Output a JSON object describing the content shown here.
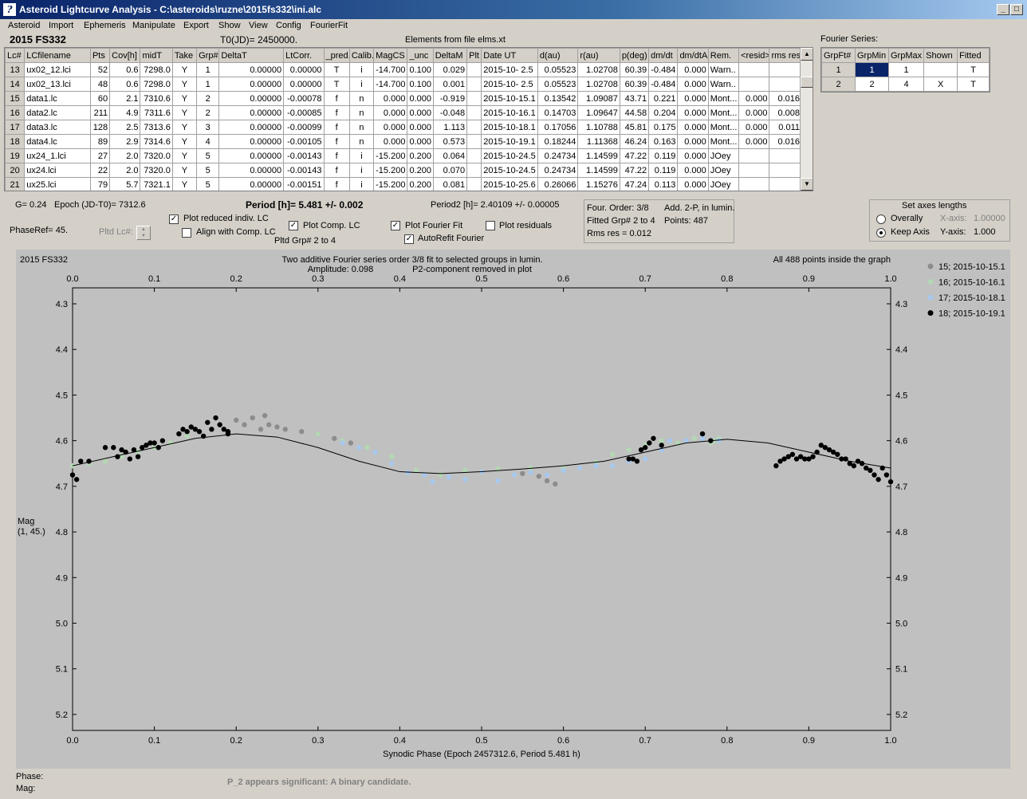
{
  "window": {
    "title": "Asteroid Lightcurve Analysis - C:\\asteroids\\ruzne\\2015fs332\\ini.alc",
    "icon": "curve-icon",
    "minimize": "_",
    "maximize": "□",
    "close": "×"
  },
  "menu": [
    "Asteroid",
    "Import",
    "Ephemeris",
    "Manipulate",
    "Export",
    "Show",
    "View",
    "Config",
    "FourierFit"
  ],
  "header": {
    "asteroid": "2015 FS332",
    "t0": "T0(JD)= 2450000.",
    "elements": "Elements from file elms.xt"
  },
  "lc_table": {
    "columns": [
      "Lc#",
      "LCfilename",
      "Pts",
      "Cov[h]",
      "midT",
      "Take",
      "Grp#",
      "DeltaT",
      "LtCorr.",
      "_pred.",
      "Calib.",
      "MagCS",
      "_unc",
      "DeltaM",
      "Plt",
      "Date UT",
      "d(au)",
      "r(au)",
      "p(deg)",
      "dm/dt",
      "dm/dtA",
      "Rem.",
      "<resid>",
      "rms res"
    ],
    "rows": [
      [
        "13",
        "ux02_12.lci",
        "52",
        "0.6",
        "7298.0",
        "Y",
        "1",
        "0.00000",
        "0.00000",
        "T",
        "i",
        "-14.700",
        "0.100",
        "0.029",
        "",
        "2015-10- 2.5",
        "0.05523",
        "1.02708",
        "60.39",
        "-0.484",
        "0.000",
        "Warn..",
        "",
        ""
      ],
      [
        "14",
        "ux02_13.lci",
        "48",
        "0.6",
        "7298.0",
        "Y",
        "1",
        "0.00000",
        "0.00000",
        "T",
        "i",
        "-14.700",
        "0.100",
        "0.001",
        "",
        "2015-10- 2.5",
        "0.05523",
        "1.02708",
        "60.39",
        "-0.484",
        "0.000",
        "Warn..",
        "",
        ""
      ],
      [
        "15",
        "data1.lc",
        "60",
        "2.1",
        "7310.6",
        "Y",
        "2",
        "0.00000",
        "-0.00078",
        "f",
        "n",
        "0.000",
        "0.000",
        "-0.919",
        "",
        "2015-10-15.1",
        "0.13542",
        "1.09087",
        "43.71",
        "0.221",
        "0.000",
        "Mont...",
        "0.000",
        "0.016"
      ],
      [
        "16",
        "data2.lc",
        "211",
        "4.9",
        "7311.6",
        "Y",
        "2",
        "0.00000",
        "-0.00085",
        "f",
        "n",
        "0.000",
        "0.000",
        "-0.048",
        "",
        "2015-10-16.1",
        "0.14703",
        "1.09647",
        "44.58",
        "0.204",
        "0.000",
        "Mont...",
        "0.000",
        "0.008"
      ],
      [
        "17",
        "data3.lc",
        "128",
        "2.5",
        "7313.6",
        "Y",
        "3",
        "0.00000",
        "-0.00099",
        "f",
        "n",
        "0.000",
        "0.000",
        "1.113",
        "",
        "2015-10-18.1",
        "0.17056",
        "1.10788",
        "45.81",
        "0.175",
        "0.000",
        "Mont...",
        "0.000",
        "0.011"
      ],
      [
        "18",
        "data4.lc",
        "89",
        "2.9",
        "7314.6",
        "Y",
        "4",
        "0.00000",
        "-0.00105",
        "f",
        "n",
        "0.000",
        "0.000",
        "0.573",
        "",
        "2015-10-19.1",
        "0.18244",
        "1.11368",
        "46.24",
        "0.163",
        "0.000",
        "Mont...",
        "0.000",
        "0.016"
      ],
      [
        "19",
        "ux24_1.lci",
        "27",
        "2.0",
        "7320.0",
        "Y",
        "5",
        "0.00000",
        "-0.00143",
        "f",
        "i",
        "-15.200",
        "0.200",
        "0.064",
        "",
        "2015-10-24.5",
        "0.24734",
        "1.14599",
        "47.22",
        "0.119",
        "0.000",
        "JOey",
        "",
        ""
      ],
      [
        "20",
        "ux24.lci",
        "22",
        "2.0",
        "7320.0",
        "Y",
        "5",
        "0.00000",
        "-0.00143",
        "f",
        "i",
        "-15.200",
        "0.200",
        "0.070",
        "",
        "2015-10-24.5",
        "0.24734",
        "1.14599",
        "47.22",
        "0.119",
        "0.000",
        "JOey",
        "",
        ""
      ],
      [
        "21",
        "ux25.lci",
        "79",
        "5.7",
        "7321.1",
        "Y",
        "5",
        "0.00000",
        "-0.00151",
        "f",
        "i",
        "-15.200",
        "0.200",
        "0.081",
        "",
        "2015-10-25.6",
        "0.26066",
        "1.15276",
        "47.24",
        "0.113",
        "0.000",
        "JOey",
        "",
        ""
      ]
    ]
  },
  "fourier_series": {
    "title": "Fourier Series:",
    "columns": [
      "GrpFt#",
      "GrpMin",
      "GrpMax",
      "Shown",
      "Fitted"
    ],
    "rows": [
      [
        "1",
        "1",
        "1",
        "",
        "T"
      ],
      [
        "2",
        "2",
        "4",
        "X",
        "T"
      ]
    ]
  },
  "controls": {
    "g": "G= 0.24",
    "epoch": "Epoch (JD-T0)= 7312.6",
    "period": "Period [h]= 5.481 +/- 0.002",
    "period2": "Period2 [h]= 2.40109 +/- 0.00005",
    "phaseref": "PhaseRef= 45.",
    "pltd_lc": "Pltd Lc#:",
    "plot_reduced": "Plot reduced indiv. LC",
    "align_comp": "Align with Comp. LC",
    "plot_comp": "Plot Comp. LC",
    "pltd_grp": "Pltd Grp#  2   to   4",
    "plot_fourier": "Plot Fourier Fit",
    "autorefit": "AutoRefit Fourier",
    "plot_residuals": "Plot residuals",
    "checks": {
      "plot_reduced": true,
      "align_comp": false,
      "plot_comp": true,
      "plot_fourier": true,
      "autorefit": true,
      "plot_residuals": false
    }
  },
  "fit_info": {
    "order": "Four. Order:  3/8",
    "add": "Add. 2-P, in lumin.",
    "fitted": "Fitted Grp# 2 to 4",
    "points": "Points: 487",
    "rms": "Rms res     = 0.012"
  },
  "axes": {
    "title": "Set axes lengths",
    "overally": "Overally",
    "keep": "Keep Axis",
    "xaxis_label": "X-axis:",
    "xaxis_value": "1.00000",
    "yaxis_label": "Y-axis:",
    "yaxis_value": "1.000",
    "selected": "keep"
  },
  "plot": {
    "name": "2015 FS332",
    "title": "Two additive Fourier series order 3/8 fit to selected groups in lumin.",
    "amplitude": "Amplitude: 0.098",
    "p2note": "P2-component removed in plot",
    "points_note": "All 488 points inside the graph",
    "ylabel": "Mag",
    "ylabel2": "(1, 45.)",
    "xlabel": "Synodic Phase (Epoch 2457312.6, Period 5.481 h)",
    "x_ticks": [
      "0.0",
      "0.1",
      "0.2",
      "0.3",
      "0.4",
      "0.5",
      "0.6",
      "0.7",
      "0.8",
      "0.9",
      "1.0"
    ],
    "y_ticks": [
      "4.3",
      "4.4",
      "4.5",
      "4.6",
      "4.7",
      "4.8",
      "4.9",
      "5.0",
      "5.1",
      "5.2"
    ]
  },
  "chart_data": {
    "type": "scatter",
    "title": "Two additive Fourier series order 3/8 fit to selected groups in lumin.",
    "xlabel": "Synodic Phase (Epoch 2457312.6, Period 5.481 h)",
    "ylabel": "Mag",
    "xlim": [
      0.0,
      1.0
    ],
    "ylim": [
      4.3,
      5.27
    ],
    "y_inverted": true,
    "legend_position": "right",
    "series": [
      {
        "name": "15; 2015-10-15.1",
        "color": "#8c8c8c",
        "x": [
          0.2,
          0.21,
          0.22,
          0.23,
          0.235,
          0.24,
          0.25,
          0.26,
          0.28,
          0.3,
          0.32,
          0.34,
          0.55,
          0.56,
          0.57,
          0.58,
          0.59
        ],
        "y": [
          4.555,
          4.565,
          4.55,
          4.575,
          4.545,
          4.565,
          4.57,
          4.575,
          4.58,
          4.585,
          4.595,
          4.605,
          4.672,
          4.67,
          4.678,
          4.688,
          4.695
        ]
      },
      {
        "name": "16; 2015-10-16.1",
        "color": "#b4d7b4",
        "x": [
          0.0,
          0.02,
          0.04,
          0.06,
          0.08,
          0.1,
          0.12,
          0.14,
          0.16,
          0.3,
          0.33,
          0.36,
          0.39,
          0.42,
          0.45,
          0.48,
          0.52,
          0.56,
          0.6,
          0.64,
          0.66,
          0.68,
          0.7,
          0.72,
          0.74,
          0.76,
          0.78,
          0.785,
          0.79
        ],
        "y": [
          4.655,
          4.65,
          4.645,
          4.635,
          4.625,
          4.615,
          4.605,
          4.59,
          4.59,
          4.585,
          4.6,
          4.615,
          4.635,
          4.665,
          4.675,
          4.665,
          4.662,
          4.66,
          4.66,
          4.647,
          4.63,
          4.62,
          4.61,
          4.6,
          4.605,
          4.595,
          4.605,
          4.6,
          4.595
        ]
      },
      {
        "name": "17; 2015-10-18.1",
        "color": "#a8c8ec",
        "x": [
          0.33,
          0.35,
          0.37,
          0.39,
          0.41,
          0.43,
          0.44,
          0.46,
          0.48,
          0.5,
          0.52,
          0.54,
          0.56,
          0.58,
          0.6,
          0.62,
          0.64,
          0.66,
          0.68,
          0.7,
          0.72,
          0.73,
          0.75,
          0.77,
          0.79
        ],
        "y": [
          4.605,
          4.615,
          4.625,
          4.65,
          4.67,
          4.675,
          4.69,
          4.68,
          4.685,
          4.668,
          4.688,
          4.675,
          4.67,
          4.675,
          4.665,
          4.66,
          4.655,
          4.655,
          4.645,
          4.64,
          4.62,
          4.6,
          4.6,
          4.595,
          4.6
        ]
      },
      {
        "name": "18; 2015-10-19.1",
        "color": "#000000",
        "x": [
          0.0,
          0.005,
          0.01,
          0.02,
          0.04,
          0.05,
          0.055,
          0.06,
          0.065,
          0.07,
          0.075,
          0.08,
          0.085,
          0.09,
          0.095,
          0.1,
          0.105,
          0.11,
          0.13,
          0.135,
          0.14,
          0.145,
          0.15,
          0.155,
          0.16,
          0.165,
          0.17,
          0.175,
          0.18,
          0.185,
          0.19,
          0.19,
          0.68,
          0.685,
          0.69,
          0.695,
          0.7,
          0.705,
          0.71,
          0.72,
          0.77,
          0.78,
          0.86,
          0.865,
          0.87,
          0.875,
          0.88,
          0.885,
          0.89,
          0.895,
          0.9,
          0.905,
          0.91,
          0.915,
          0.92,
          0.925,
          0.93,
          0.935,
          0.94,
          0.945,
          0.95,
          0.955,
          0.96,
          0.965,
          0.97,
          0.975,
          0.98,
          0.985,
          0.99,
          0.995,
          1.0
        ],
        "y": [
          4.675,
          4.685,
          4.645,
          4.645,
          4.615,
          4.615,
          4.635,
          4.62,
          4.625,
          4.64,
          4.62,
          4.635,
          4.615,
          4.61,
          4.605,
          4.605,
          4.615,
          4.6,
          4.585,
          4.575,
          4.58,
          4.57,
          4.575,
          4.58,
          4.59,
          4.56,
          4.575,
          4.55,
          4.565,
          4.575,
          4.585,
          4.58,
          4.64,
          4.64,
          4.645,
          4.62,
          4.615,
          4.605,
          4.595,
          4.61,
          4.585,
          4.6,
          4.655,
          4.645,
          4.64,
          4.635,
          4.63,
          4.64,
          4.635,
          4.64,
          4.64,
          4.635,
          4.625,
          4.61,
          4.615,
          4.62,
          4.625,
          4.63,
          4.64,
          4.64,
          4.65,
          4.655,
          4.645,
          4.65,
          4.66,
          4.665,
          4.675,
          4.685,
          4.66,
          4.675,
          4.69
        ]
      }
    ],
    "fit_curve": {
      "x": [
        0.0,
        0.05,
        0.1,
        0.15,
        0.2,
        0.25,
        0.3,
        0.35,
        0.4,
        0.45,
        0.5,
        0.55,
        0.6,
        0.65,
        0.7,
        0.75,
        0.8,
        0.85,
        0.9,
        0.95,
        1.0
      ],
      "y": [
        4.655,
        4.635,
        4.615,
        4.595,
        4.585,
        4.592,
        4.615,
        4.645,
        4.668,
        4.672,
        4.668,
        4.662,
        4.655,
        4.645,
        4.625,
        4.605,
        4.597,
        4.605,
        4.625,
        4.645,
        4.66
      ]
    }
  },
  "status": {
    "phase": "Phase:",
    "mag": "Mag:",
    "message": "P_2 appears significant: A binary candidate."
  }
}
